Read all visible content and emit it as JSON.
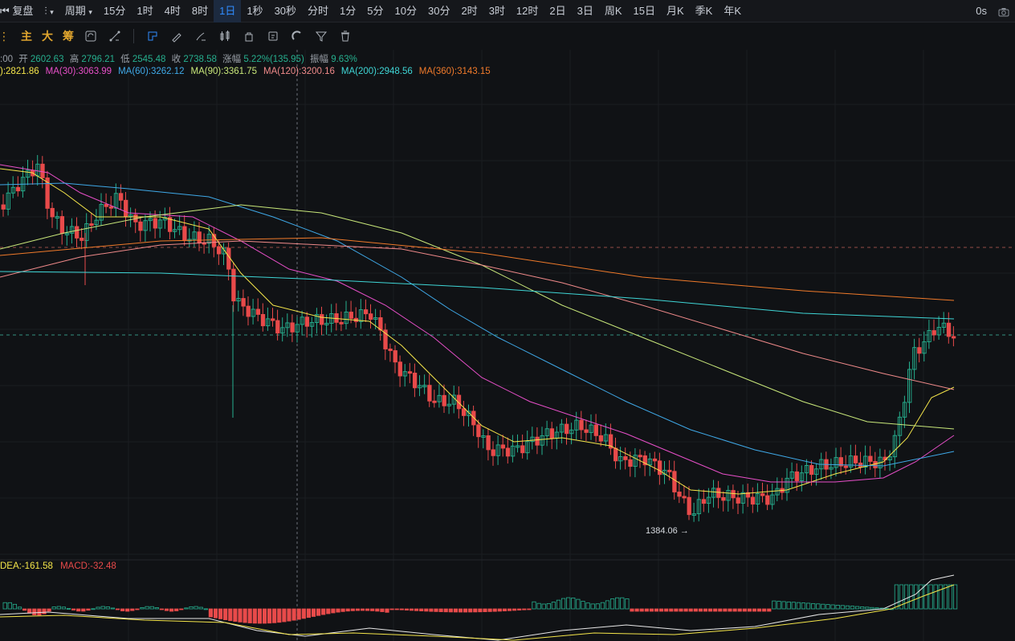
{
  "toolbar": {
    "restore_label": "复盘",
    "period_label": "周期",
    "intervals": [
      "15分",
      "1时",
      "4时",
      "8时",
      "1日",
      "1秒",
      "30秒",
      "分时",
      "1分",
      "5分",
      "10分",
      "30分",
      "2时",
      "3时",
      "12时",
      "2日",
      "3日",
      "周K",
      "15日",
      "月K",
      "季K",
      "年K"
    ],
    "active_interval": "1日",
    "countdown": "0s"
  },
  "drawbar": {
    "main_label": "主",
    "big_label": "大",
    "chip_label": "筹"
  },
  "ohlc": {
    "time_fragment": ":00",
    "open_label": "开",
    "open": "2602.63",
    "high_label": "高",
    "high": "2796.21",
    "low_label": "低",
    "low": "2545.48",
    "close_label": "收",
    "close": "2738.58",
    "change_label": "涨幅",
    "change": "5.22%(135.95)",
    "amp_label": "振幅",
    "amp": "9.63%"
  },
  "ma_legend": [
    {
      "label": ")",
      "value": ":2821.86",
      "color": "#f5e64a"
    },
    {
      "label": "MA(30)",
      "value": ":3063.99",
      "color": "#e84fc9"
    },
    {
      "label": "MA(60)",
      "value": ":3262.12",
      "color": "#3fa9e8"
    },
    {
      "label": "MA(90)",
      "value": ":3361.75",
      "color": "#c9e87a"
    },
    {
      "label": "MA(120)",
      "value": ":3200.16",
      "color": "#f08a8a"
    },
    {
      "label": "MA(200)",
      "value": ":2948.56",
      "color": "#3fd6d6"
    },
    {
      "label": "MA(360)",
      "value": ":3143.15",
      "color": "#f07a2a"
    }
  ],
  "low_marker": "1384.06",
  "macd_legend": {
    "dea_label": "DEA",
    "dea": ":-161.58",
    "dea_color": "#f5e64a",
    "macd_label": "MACD",
    "macd": ":-32.48",
    "macd_color": "#e84a4a"
  },
  "colors": {
    "up": "#26b08f",
    "down": "#e84a4a",
    "accent": "#2f8cff"
  }
}
